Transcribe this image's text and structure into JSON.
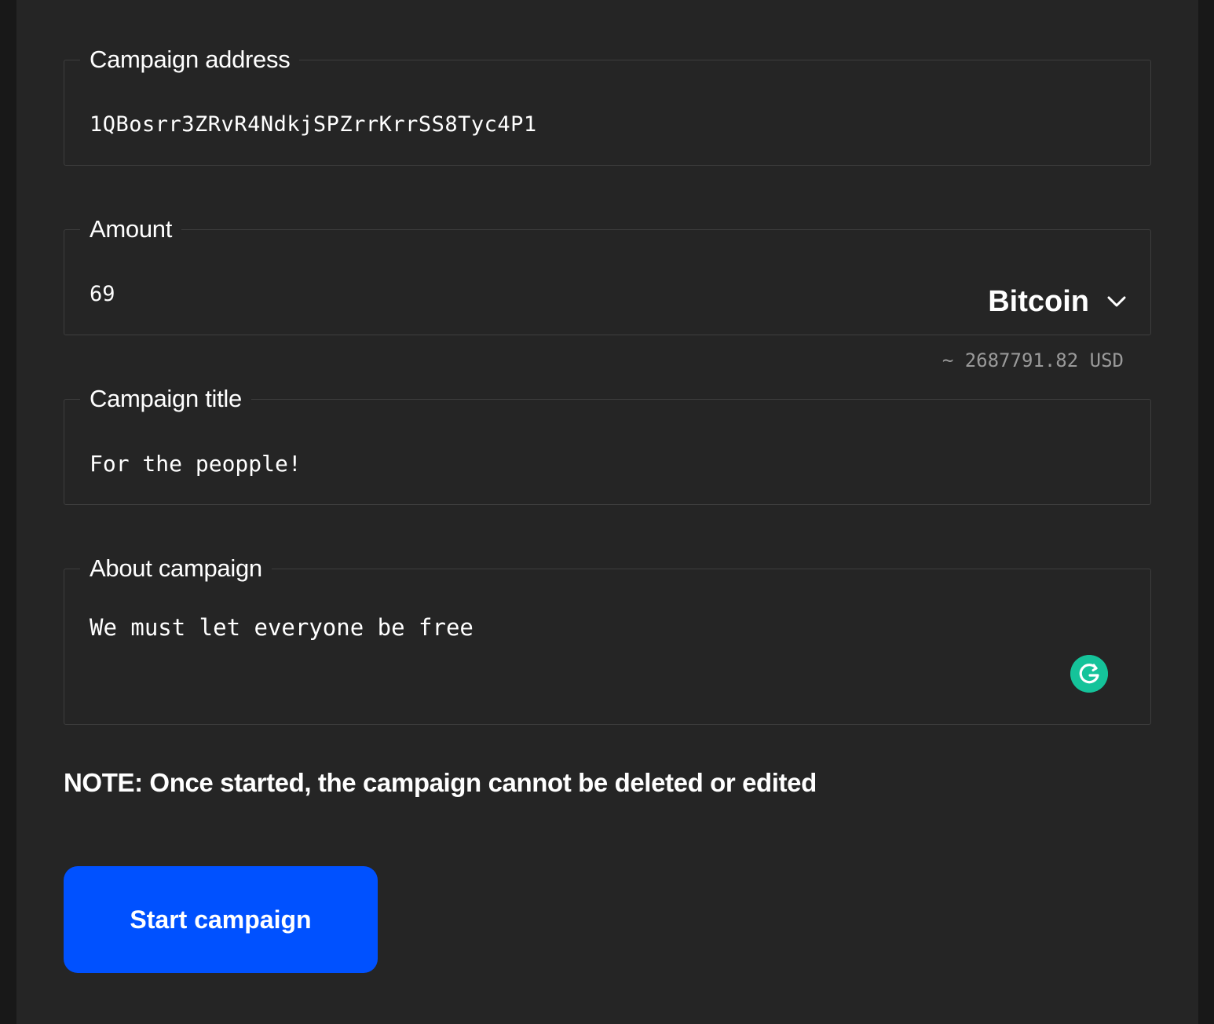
{
  "form": {
    "address": {
      "label": "Campaign address",
      "value": "1QBosrr3ZRvR4NdkjSPZrrKrrSS8Tyc4P1"
    },
    "amount": {
      "label": "Amount",
      "value": "69",
      "currency": "Bitcoin",
      "usd_estimate": "~ 2687791.82 USD"
    },
    "title": {
      "label": "Campaign title",
      "value": "For the peopple!"
    },
    "about": {
      "label": "About campaign",
      "value": "We must let everyone be free"
    },
    "note": "NOTE: Once started, the campaign cannot be deleted or edited",
    "submit_label": "Start campaign"
  },
  "icons": {
    "currency_dropdown": "chevron-down-icon",
    "grammar_assistant": "grammarly-icon"
  },
  "colors": {
    "background": "#252525",
    "accent": "#0051ff",
    "grammarly": "#15c39a",
    "border": "#3e3e3e",
    "muted_text": "#9a9a9a"
  }
}
